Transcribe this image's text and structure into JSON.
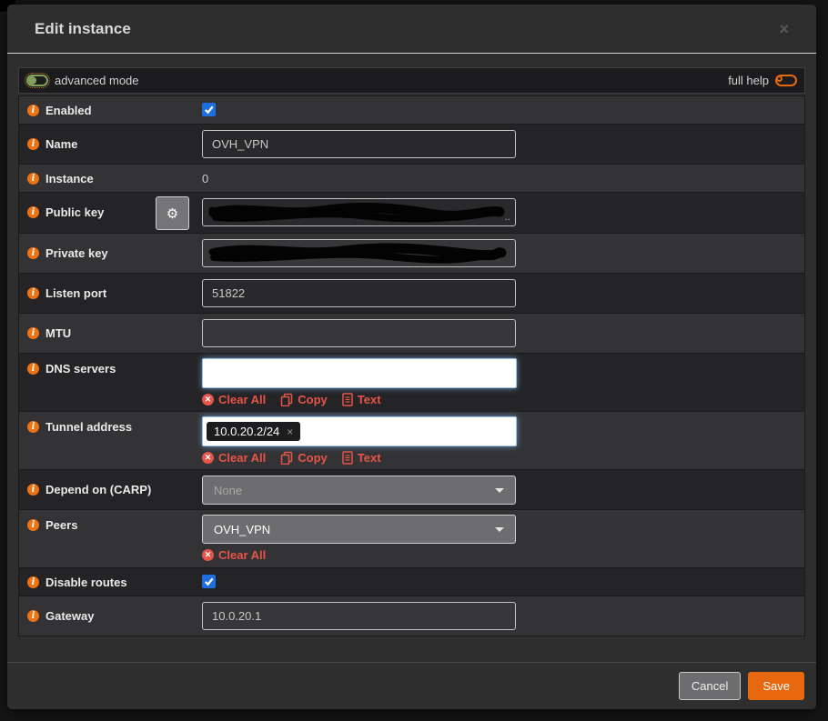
{
  "window": {
    "title": "Edit instance",
    "close_glyph": "×"
  },
  "toolbar": {
    "advanced_mode_label": "advanced mode",
    "full_help_label": "full help"
  },
  "icons": {
    "gear": "⚙",
    "clear_x": "✕"
  },
  "form": {
    "rows": [
      {
        "label": "Enabled",
        "control": "checkbox",
        "checked": true
      },
      {
        "label": "Name",
        "control": "text",
        "value": "OVH_VPN"
      },
      {
        "label": "Instance",
        "control": "static",
        "value": "0"
      },
      {
        "label": "Public key",
        "control": "redacted",
        "suffix": "..",
        "has_gear_button": true
      },
      {
        "label": "Private key",
        "control": "redacted"
      },
      {
        "label": "Listen port",
        "control": "text",
        "value": "51822"
      },
      {
        "label": "MTU",
        "control": "text",
        "value": ""
      },
      {
        "label": "DNS servers",
        "control": "tokens",
        "tokens": [],
        "actions": {
          "clear": "Clear All",
          "copy": "Copy",
          "text": "Text"
        }
      },
      {
        "label": "Tunnel address",
        "control": "tokens",
        "tokens": [
          "10.0.20.2/24"
        ],
        "token_remove_glyph": "×",
        "actions": {
          "clear": "Clear All",
          "copy": "Copy",
          "text": "Text"
        }
      },
      {
        "label": "Depend on (CARP)",
        "control": "select",
        "value": "None",
        "disabled": true
      },
      {
        "label": "Peers",
        "control": "select",
        "value": "OVH_VPN",
        "actions": {
          "clear": "Clear All"
        }
      },
      {
        "label": "Disable routes",
        "control": "checkbox",
        "checked": true
      },
      {
        "label": "Gateway",
        "control": "text",
        "value": "10.0.20.1"
      }
    ]
  },
  "footer": {
    "cancel_label": "Cancel",
    "save_label": "Save"
  },
  "colors": {
    "accent_orange": "#e8680f",
    "link_red": "#e8544a",
    "checkbox_blue": "#1d6ede",
    "row_light": "#333335",
    "row_dark": "#242426"
  }
}
